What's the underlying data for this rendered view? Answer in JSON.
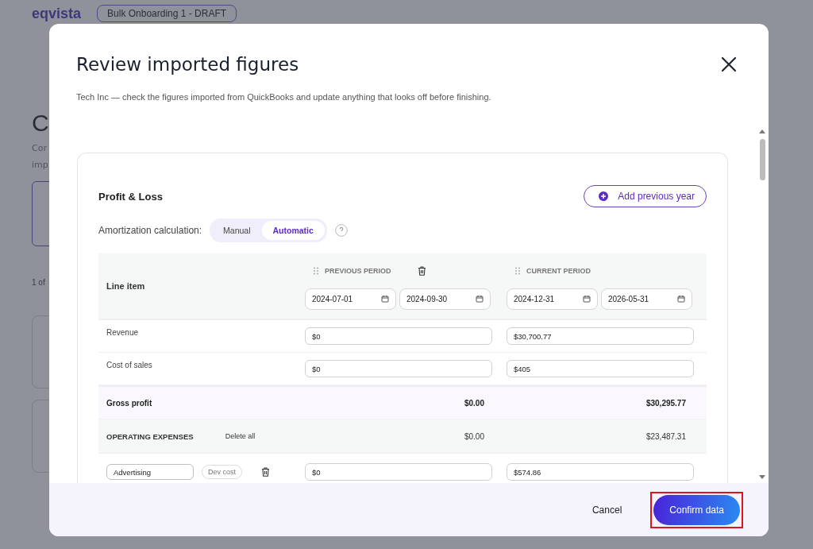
{
  "background": {
    "logo": "eqvista",
    "project_dropdown": "Bulk Onboarding 1 - DRAFT",
    "heading_fragment": "C",
    "text_fragments": [
      "Cor",
      "imp"
    ],
    "pager_fragment": "1 of"
  },
  "modal": {
    "title": "Review imported figures",
    "subtitle": "Tech Inc — check the figures imported from QuickBooks and update anything that looks off before finishing."
  },
  "section": {
    "title": "Profit & Loss",
    "add_button": "Add previous year",
    "amortization": {
      "label": "Amortization calculation:",
      "options": [
        {
          "label": "Manual",
          "selected": false
        },
        {
          "label": "Automatic",
          "selected": true
        }
      ]
    }
  },
  "table": {
    "line_item_heading": "Line item",
    "periods": [
      {
        "label": "PREVIOUS PERIOD",
        "deletable": true,
        "start": "2024-07-01",
        "end": "2024-09-30"
      },
      {
        "label": "CURRENT PERIOD",
        "deletable": false,
        "start": "2024-12-31",
        "end": "2026-05-31"
      }
    ],
    "rows": [
      {
        "kind": "input",
        "label": "Revenue",
        "values": [
          "$0",
          "$30,700.77"
        ]
      },
      {
        "kind": "input",
        "label": "Cost of sales",
        "values": [
          "$0",
          "$405"
        ]
      },
      {
        "kind": "total",
        "label": "Gross profit",
        "values": [
          "$0.00",
          "$30,295.77"
        ]
      },
      {
        "kind": "group",
        "label": "OPERATING EXPENSES",
        "action": "Delete all",
        "values": [
          "$0.00",
          "$23,487.31"
        ]
      },
      {
        "kind": "editable",
        "label": "Advertising",
        "tag": "Dev cost",
        "values": [
          "$0",
          "$574.86"
        ]
      }
    ]
  },
  "footer": {
    "cancel": "Cancel",
    "confirm": "Confirm data",
    "confirm_highlighted": true
  }
}
